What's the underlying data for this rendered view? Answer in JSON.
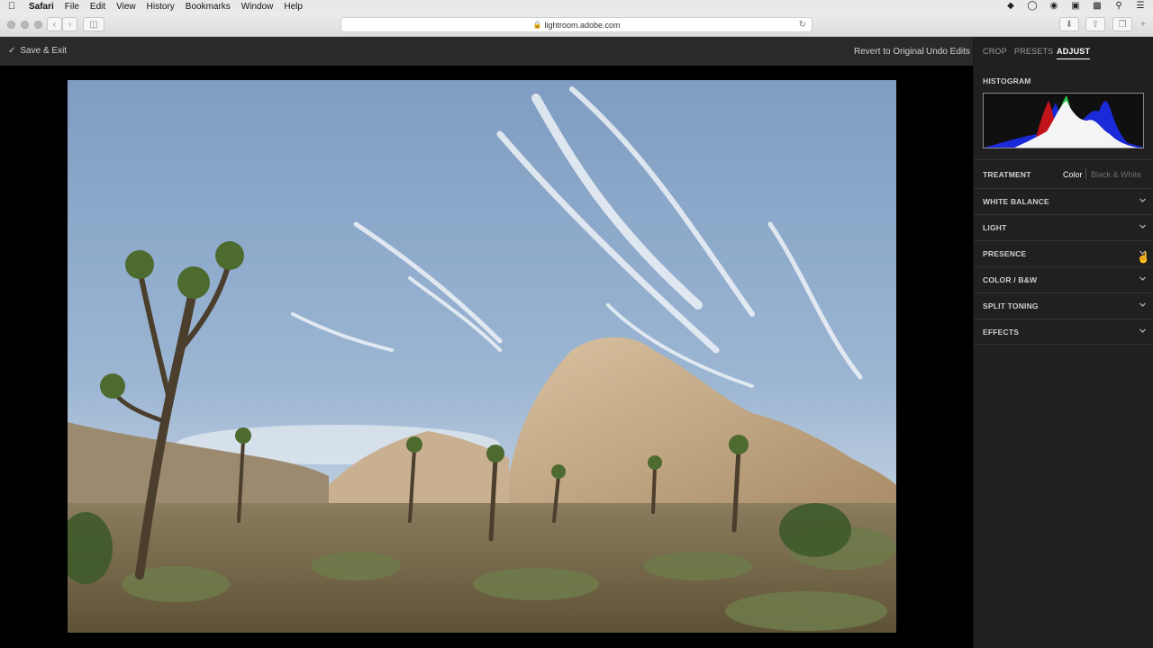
{
  "menubar": {
    "app": "Safari",
    "items": [
      "File",
      "Edit",
      "View",
      "History",
      "Bookmarks",
      "Window",
      "Help"
    ]
  },
  "browser": {
    "url": "lightroom.adobe.com"
  },
  "appbar": {
    "save_exit": "Save & Exit",
    "revert": "Revert to Original",
    "undo": "Undo Edits"
  },
  "panel": {
    "tabs": [
      "CROP",
      "PRESETS",
      "ADJUST"
    ],
    "active_tab": "ADJUST",
    "histogram_label": "HISTOGRAM",
    "treatment": {
      "label": "TREATMENT",
      "color": "Color",
      "bw": "Black & White"
    },
    "sections": [
      "WHITE BALANCE",
      "LIGHT",
      "PRESENCE",
      "COLOR / B&W",
      "SPLIT TONING",
      "EFFECTS"
    ]
  },
  "colors": {
    "panel_bg": "#202020",
    "appbar_bg": "#2a2a2a",
    "accent": "#ffffff"
  }
}
